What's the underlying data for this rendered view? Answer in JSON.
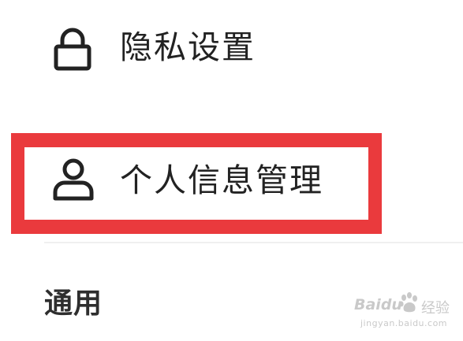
{
  "settings_list": {
    "items": [
      {
        "label": "隐私设置",
        "icon": "lock-icon"
      },
      {
        "label": "个人信息管理",
        "icon": "person-icon"
      }
    ],
    "highlight_color": "#ea3a3d"
  },
  "section": {
    "title": "通用"
  },
  "watermark": {
    "brand": "Baidu",
    "cn": "经验",
    "url": "jingyan.baidu.com"
  }
}
